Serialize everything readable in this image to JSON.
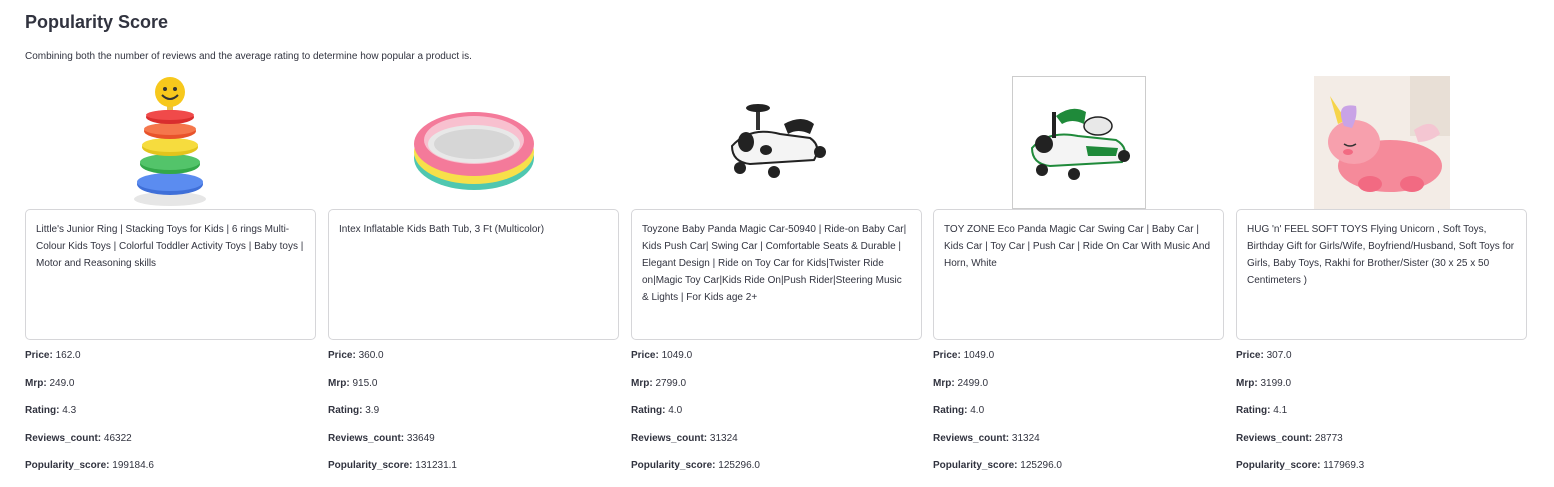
{
  "section": {
    "title": "Popularity Score",
    "description": "Combining both the number of reviews and the average rating to determine how popular a product is."
  },
  "stat_labels": {
    "price": "Price:",
    "mrp": "Mrp:",
    "rating": "Rating:",
    "reviews_count": "Reviews_count:",
    "popularity_score": "Popularity_score:"
  },
  "products": [
    {
      "image": "stacking-rings-icon",
      "description": "Little's Junior Ring | Stacking Toys for Kids | 6 rings Multi-Colour Kids Toys | Colorful Toddler Activity Toys | Baby toys | Motor and Reasoning skills",
      "price": "162.0",
      "mrp": "249.0",
      "rating": "4.3",
      "reviews_count": "46322",
      "popularity_score": "199184.6"
    },
    {
      "image": "inflatable-tub-icon",
      "description": "Intex Inflatable Kids Bath Tub, 3 Ft (Multicolor)",
      "price": "360.0",
      "mrp": "915.0",
      "rating": "3.9",
      "reviews_count": "33649",
      "popularity_score": "131231.1"
    },
    {
      "image": "panda-magic-car-icon",
      "description": "Toyzone Baby Panda Magic Car-50940 | Ride-on Baby Car| Kids Push Car| Swing Car | Comfortable Seats & Durable | Elegant Design | Ride on Toy Car for Kids|Twister Ride on|Magic Toy Car|Kids Ride On|Push Rider|Steering Music & Lights | For Kids age 2+",
      "price": "1049.0",
      "mrp": "2799.0",
      "rating": "4.0",
      "reviews_count": "31324",
      "popularity_score": "125296.0"
    },
    {
      "image": "eco-panda-car-icon",
      "description": "TOY ZONE Eco Panda Magic Car Swing Car | Baby Car | Kids Car | Toy Car | Push Car | Ride On Car With Music And Horn, White",
      "price": "1049.0",
      "mrp": "2499.0",
      "rating": "4.0",
      "reviews_count": "31324",
      "popularity_score": "125296.0"
    },
    {
      "image": "unicorn-plush-icon",
      "description": "HUG 'n' FEEL SOFT TOYS Flying Unicorn , Soft Toys, Birthday Gift for Girls/Wife, Boyfriend/Husband, Soft Toys for Girls, Baby Toys, Rakhi for Brother/Sister (30 x 25 x 50 Centimeters )",
      "price": "307.0",
      "mrp": "3199.0",
      "rating": "4.1",
      "reviews_count": "28773",
      "popularity_score": "117969.3"
    }
  ]
}
